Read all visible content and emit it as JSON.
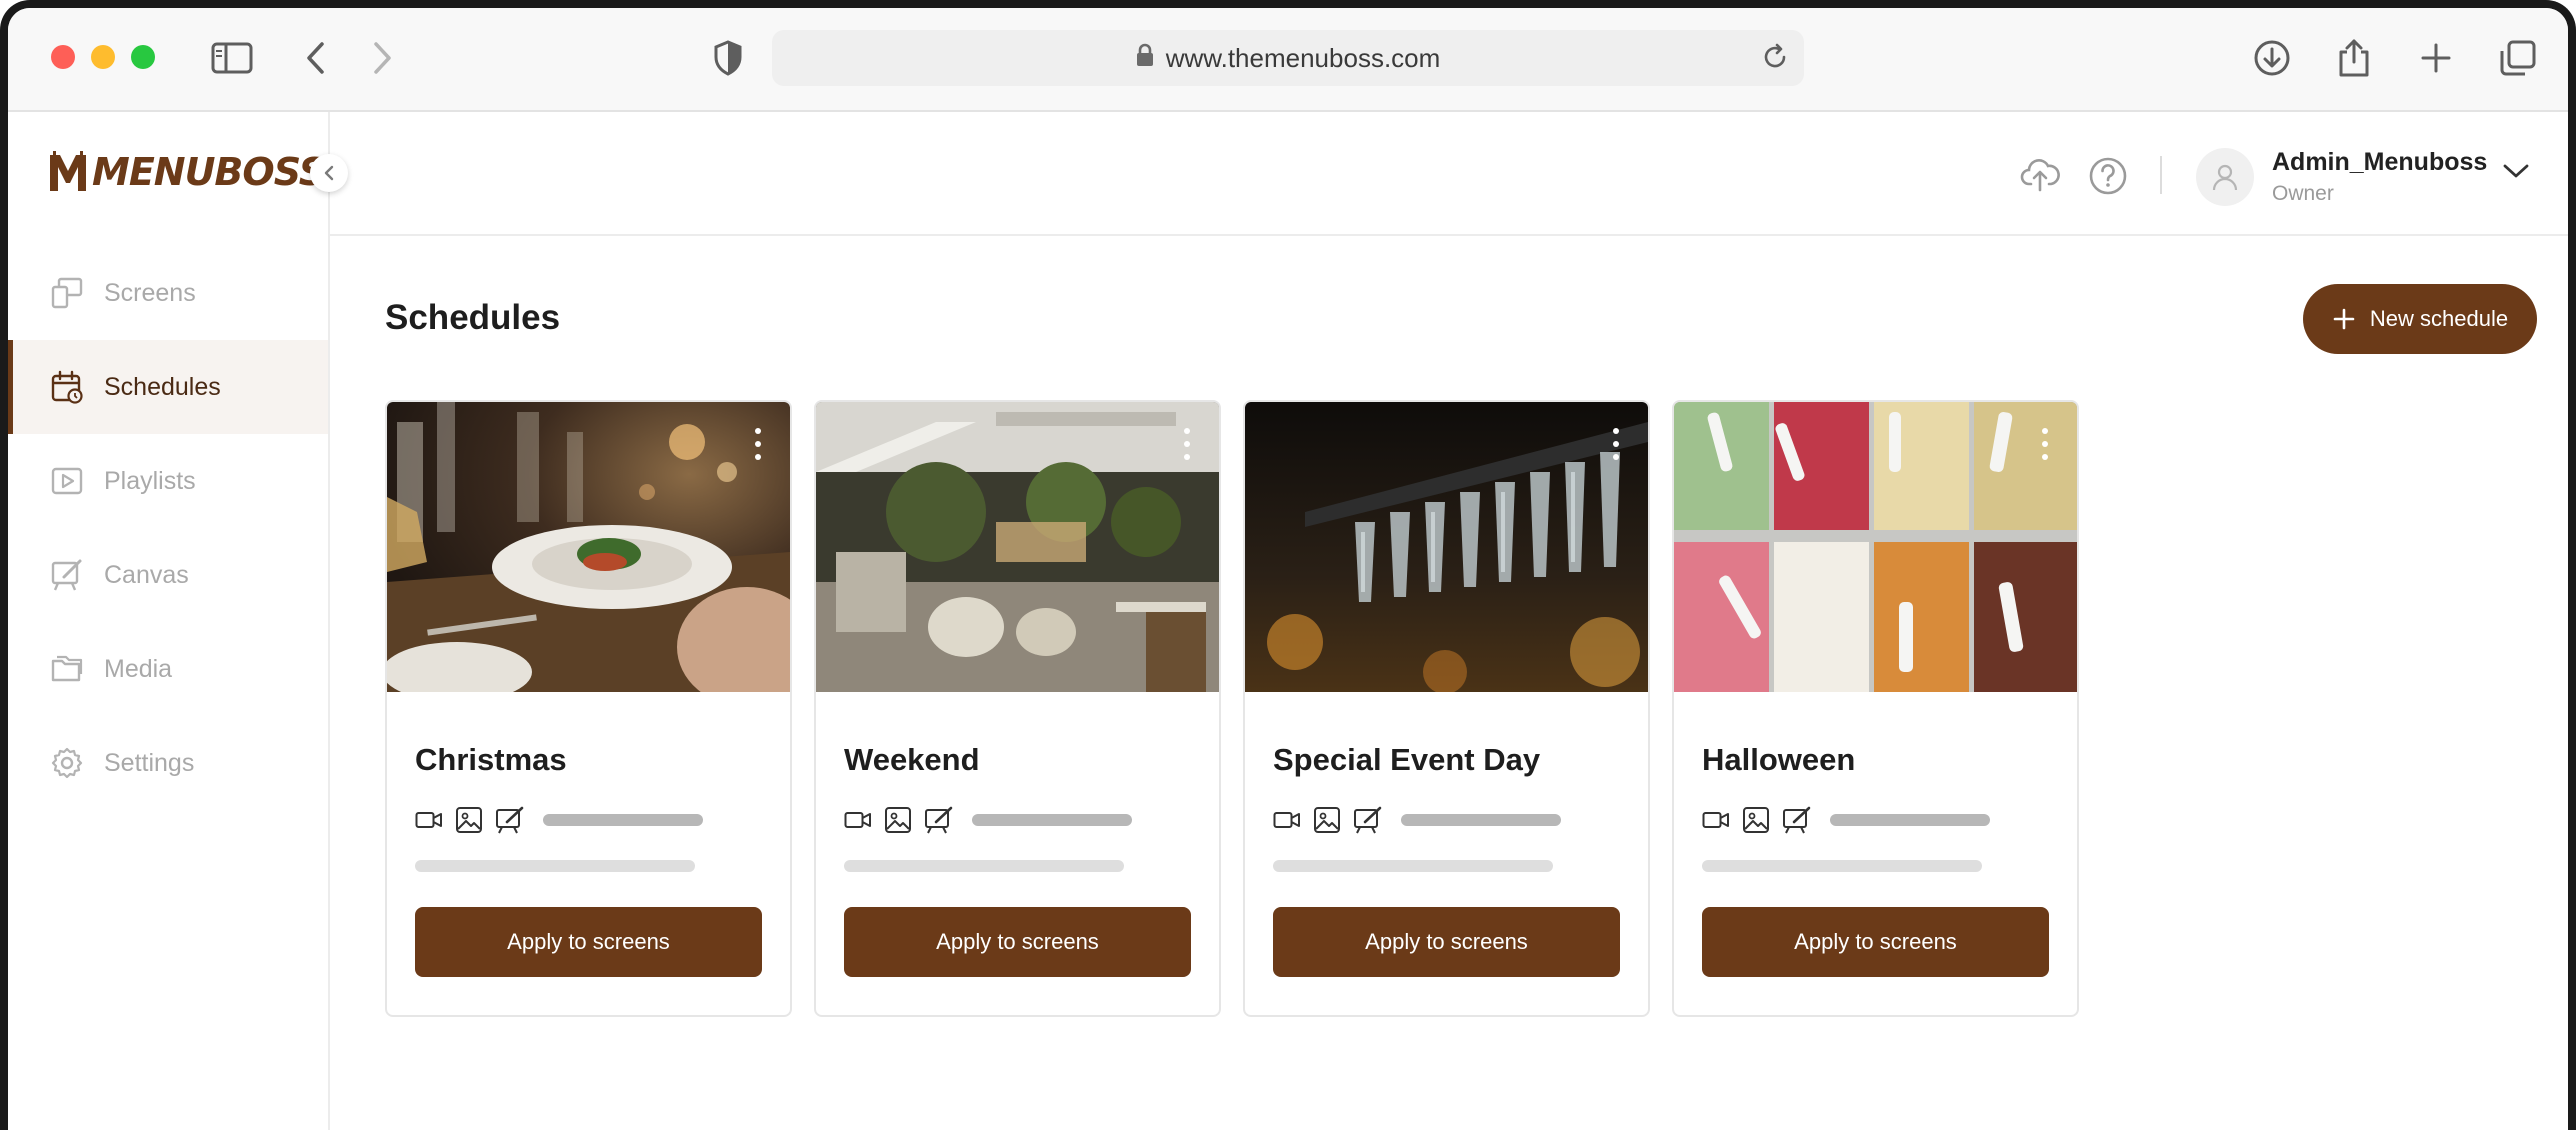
{
  "browser": {
    "url": "www.themenuboss.com"
  },
  "brand": {
    "name": "MENUBOSS",
    "accent": "#6b3a18"
  },
  "sidebar": {
    "items": [
      {
        "label": "Screens",
        "icon": "screens-icon",
        "active": false
      },
      {
        "label": "Schedules",
        "icon": "calendar-icon",
        "active": true
      },
      {
        "label": "Playlists",
        "icon": "play-icon",
        "active": false
      },
      {
        "label": "Canvas",
        "icon": "canvas-icon",
        "active": false
      },
      {
        "label": "Media",
        "icon": "media-icon",
        "active": false
      },
      {
        "label": "Settings",
        "icon": "gear-icon",
        "active": false
      }
    ]
  },
  "header": {
    "user_name": "Admin_Menuboss",
    "user_role": "Owner"
  },
  "main": {
    "title": "Schedules",
    "new_button": "New schedule"
  },
  "cards": [
    {
      "title": "Christmas",
      "button": "Apply to screens"
    },
    {
      "title": "Weekend",
      "button": "Apply to screens"
    },
    {
      "title": "Special Event Day",
      "button": "Apply to screens"
    },
    {
      "title": "Halloween",
      "button": "Apply to screens"
    }
  ]
}
